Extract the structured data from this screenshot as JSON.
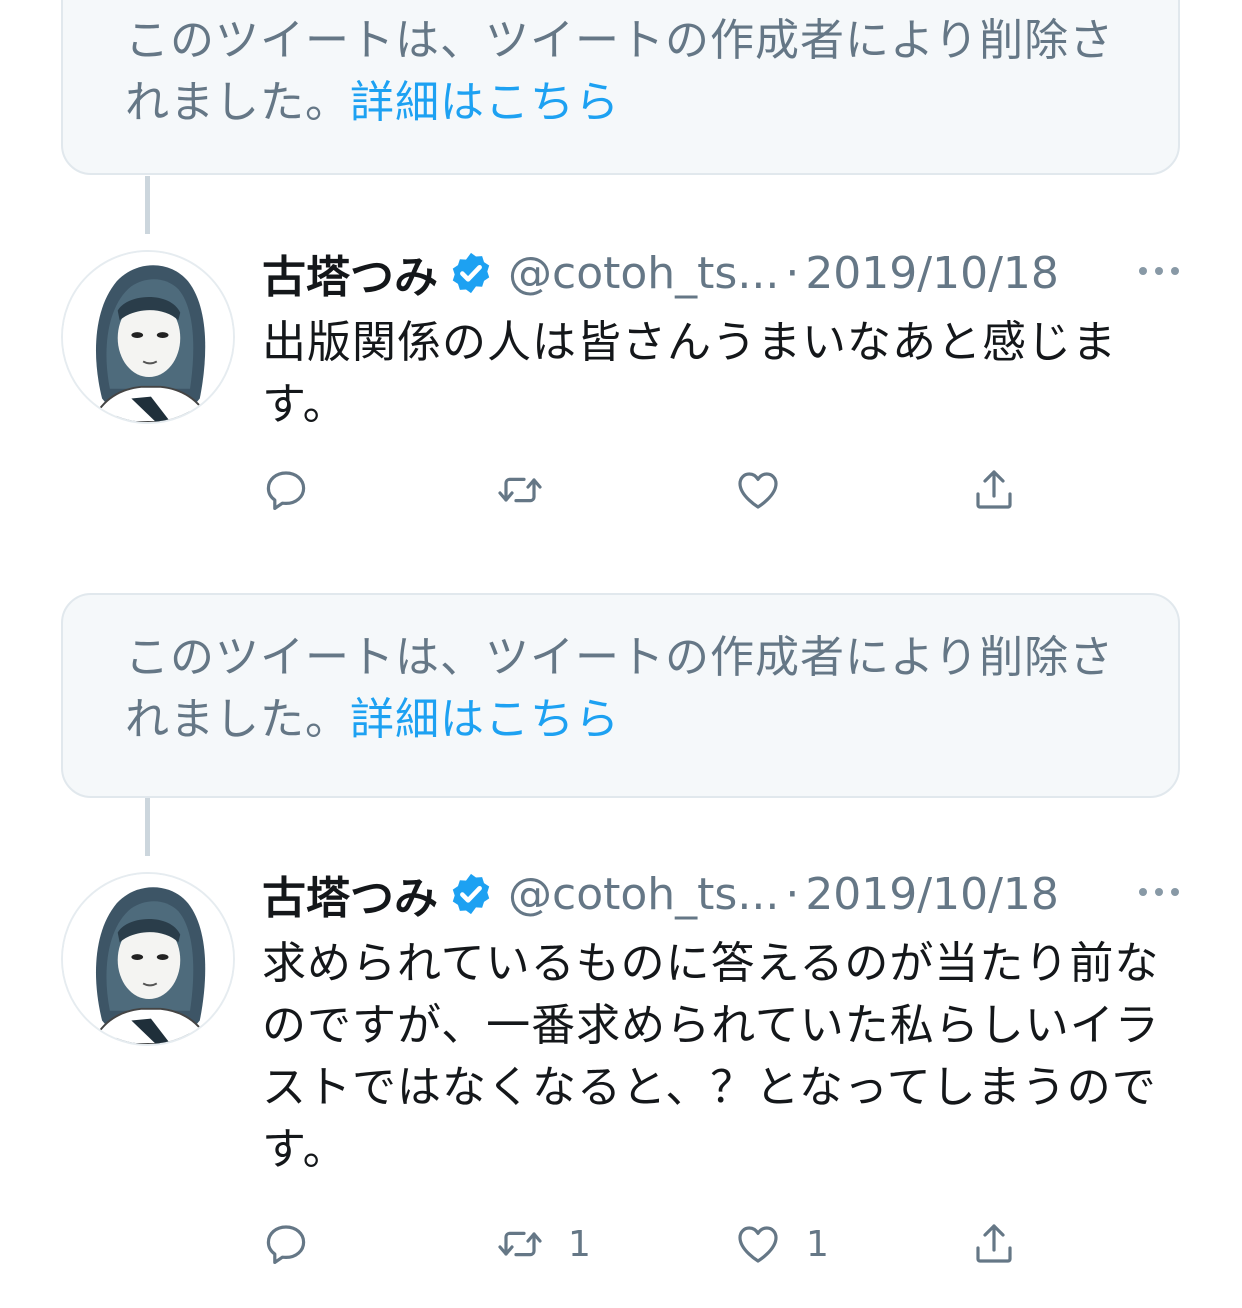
{
  "deleted_notice": {
    "text": "このツイートは、ツイートの作成者により削除されました。",
    "link": "詳細はこちら"
  },
  "tweets": [
    {
      "display_name": "古塔つみ",
      "handle": "@cotoh_ts...",
      "separator": "·",
      "date": "2019/10/18",
      "text": "出版関係の人は皆さんうまいなあと感じます。",
      "reply_count": "",
      "retweet_count": "",
      "like_count": ""
    },
    {
      "display_name": "古塔つみ",
      "handle": "@cotoh_ts...",
      "separator": "·",
      "date": "2019/10/18",
      "text": "求められているものに答えるのが当たり前なのですが、一番求められていた私らしいイラストではなくなると、？となってしまうのです。",
      "reply_count": "",
      "retweet_count": "1",
      "like_count": "1"
    }
  ],
  "icons": {
    "verified": "verified-badge-icon",
    "more": "more-dots-icon",
    "reply": "reply-icon",
    "retweet": "retweet-icon",
    "like": "heart-icon",
    "share": "share-icon"
  },
  "colors": {
    "link": "#1da1f2",
    "secondary_text": "#657786",
    "primary_text": "#14171a",
    "verified": "#1da1f2",
    "card_bg": "#f5f8fa",
    "border": "#e1e8ed"
  }
}
